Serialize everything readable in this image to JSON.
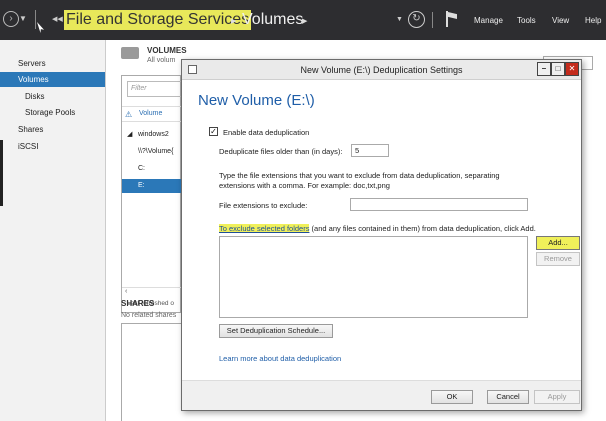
{
  "header": {
    "breadcrumb_root": "File and Storage Services",
    "breadcrumb_page": "Volumes",
    "menu": [
      "Manage",
      "Tools",
      "View",
      "Help"
    ]
  },
  "sidebar": {
    "items": [
      {
        "label": "Servers",
        "indent": false,
        "selected": false
      },
      {
        "label": "Volumes",
        "indent": false,
        "selected": true
      },
      {
        "label": "Disks",
        "indent": true,
        "selected": false
      },
      {
        "label": "Storage Pools",
        "indent": true,
        "selected": false
      },
      {
        "label": "Shares",
        "indent": false,
        "selected": false
      },
      {
        "label": "iSCSI",
        "indent": false,
        "selected": false
      }
    ]
  },
  "volumes_panel": {
    "title": "VOLUMES",
    "subtitle": "All volum",
    "filter_placeholder": "Filter",
    "column_header": "Volume",
    "rows": [
      {
        "label": "windows2",
        "prefix": "◢",
        "selected": false
      },
      {
        "label": "\\\\?\\Volume{",
        "prefix": "",
        "selected": false
      },
      {
        "label": "C:",
        "prefix": "",
        "selected": false
      },
      {
        "label": "E:",
        "prefix": "",
        "selected": true
      }
    ],
    "last_refreshed": "Last refreshed o"
  },
  "shares_panel": {
    "title": "SHARES",
    "subtitle": "No related shares"
  },
  "dialog": {
    "window_title": "New Volume (E:\\) Deduplication Settings",
    "heading": "New Volume (E:\\)",
    "enable_dedup_label": "Enable data deduplication",
    "enable_dedup_checked": true,
    "days_label": "Deduplicate files older than (in days):",
    "days_value": "5",
    "ext_help_line1": "Type the file extensions that you want to exclude from data deduplication, separating",
    "ext_help_line2": "extensions with a comma. For example: doc,txt,png",
    "ext_label": "File extensions to exclude:",
    "ext_value": "",
    "folders_help_highlight": "To exclude selected folders",
    "folders_help_rest": " (and any files contained in them) from data deduplication, click Add.",
    "add_button": "Add...",
    "remove_button": "Remove",
    "schedule_button": "Set Deduplication Schedule...",
    "learn_link": "Learn more about data deduplication",
    "ok_button": "OK",
    "cancel_button": "Cancel",
    "apply_button": "Apply"
  },
  "colors": {
    "header_bg": "#2d2d30",
    "selection_blue": "#2b78b8",
    "highlight_yellow": "#f0f05a",
    "heading_blue": "#1f5ea8",
    "close_red": "#c42b1c"
  }
}
